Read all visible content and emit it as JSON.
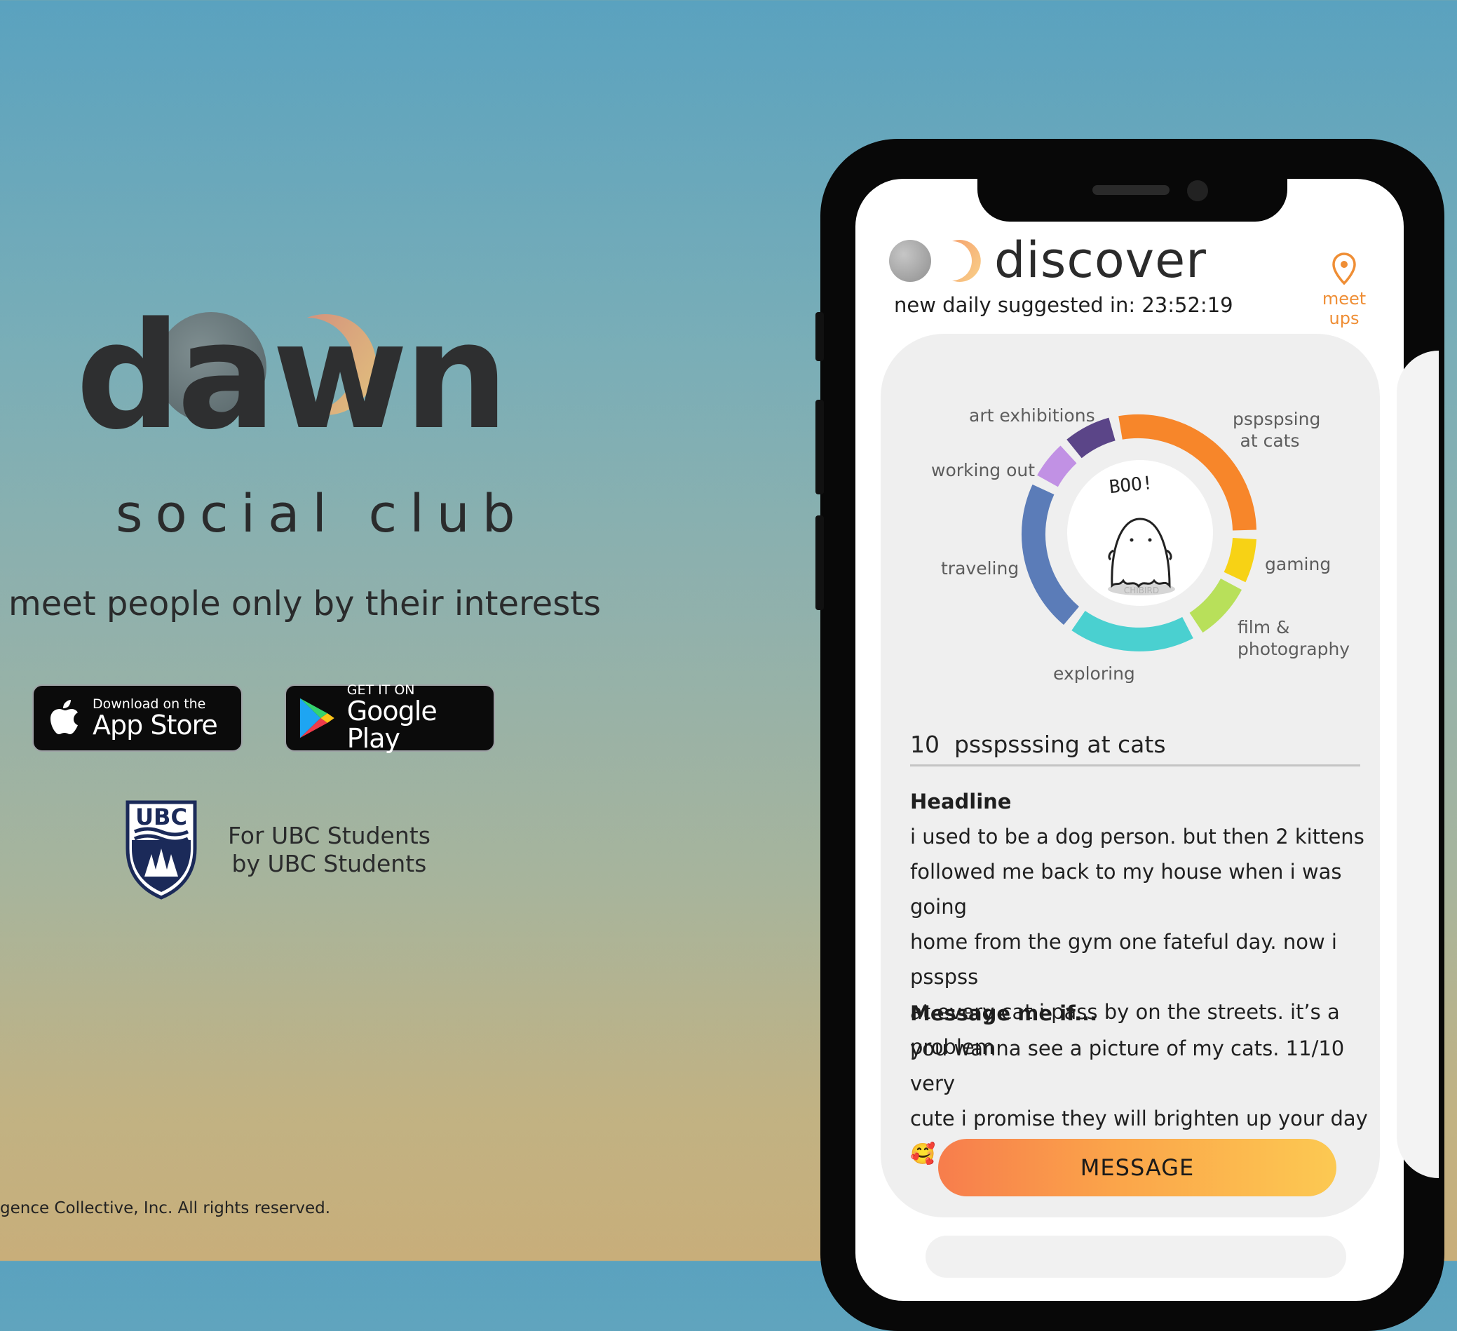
{
  "brand": {
    "logo_text": "dawn",
    "subtitle": "social club",
    "tagline": "meet people only by their interests"
  },
  "stores": {
    "appstore_small": "Download on the",
    "appstore_big": "App Store",
    "googleplay_small": "GET IT ON",
    "googleplay_big": "Google Play"
  },
  "ubc": {
    "crest_text": "UBC",
    "line1": "For UBC Students",
    "line2": "by UBC Students"
  },
  "footer": {
    "copyright": "gence Collective, Inc. All rights reserved."
  },
  "app": {
    "title": "discover",
    "suggested_label": "new daily suggested in: 23:52:19",
    "meetups_label": "meet ups",
    "ghost_text": "BOO!",
    "ghost_caption": "CHIBIRD",
    "interests": [
      {
        "label": "art exhibitions",
        "color": "#5b4588"
      },
      {
        "label": "pspspsing at cats",
        "color": "#f7862a"
      },
      {
        "label": "working out",
        "color": "#c191e4"
      },
      {
        "label": "traveling",
        "color": "#5b7cb8"
      },
      {
        "label": "gaming",
        "color": "#f7d215"
      },
      {
        "label": "film & photography",
        "color": "#b8e05a"
      },
      {
        "label": "exploring",
        "color": "#4ad0d0"
      }
    ],
    "profile": {
      "count": "10",
      "interest": "psspsssing at cats",
      "headline_label": "Headline",
      "headline_lines": [
        "i used to be a dog person. but then 2 kittens",
        "followed me back to my house when i was going",
        "home from the gym one fateful day. now i psspss",
        "at every cat i pass by on the streets. it’s a problem"
      ],
      "message_label": "Message me if...",
      "message_lines": [
        "you wanna see a picture of my cats. 11/10 very",
        "cute i promise they will brighten up your day 🥰"
      ]
    },
    "message_button": "MESSAGE"
  },
  "colors": {
    "accent_orange": "#ef8e35",
    "button_gradient_start": "#f77d4c",
    "button_gradient_end": "#fcc952"
  }
}
